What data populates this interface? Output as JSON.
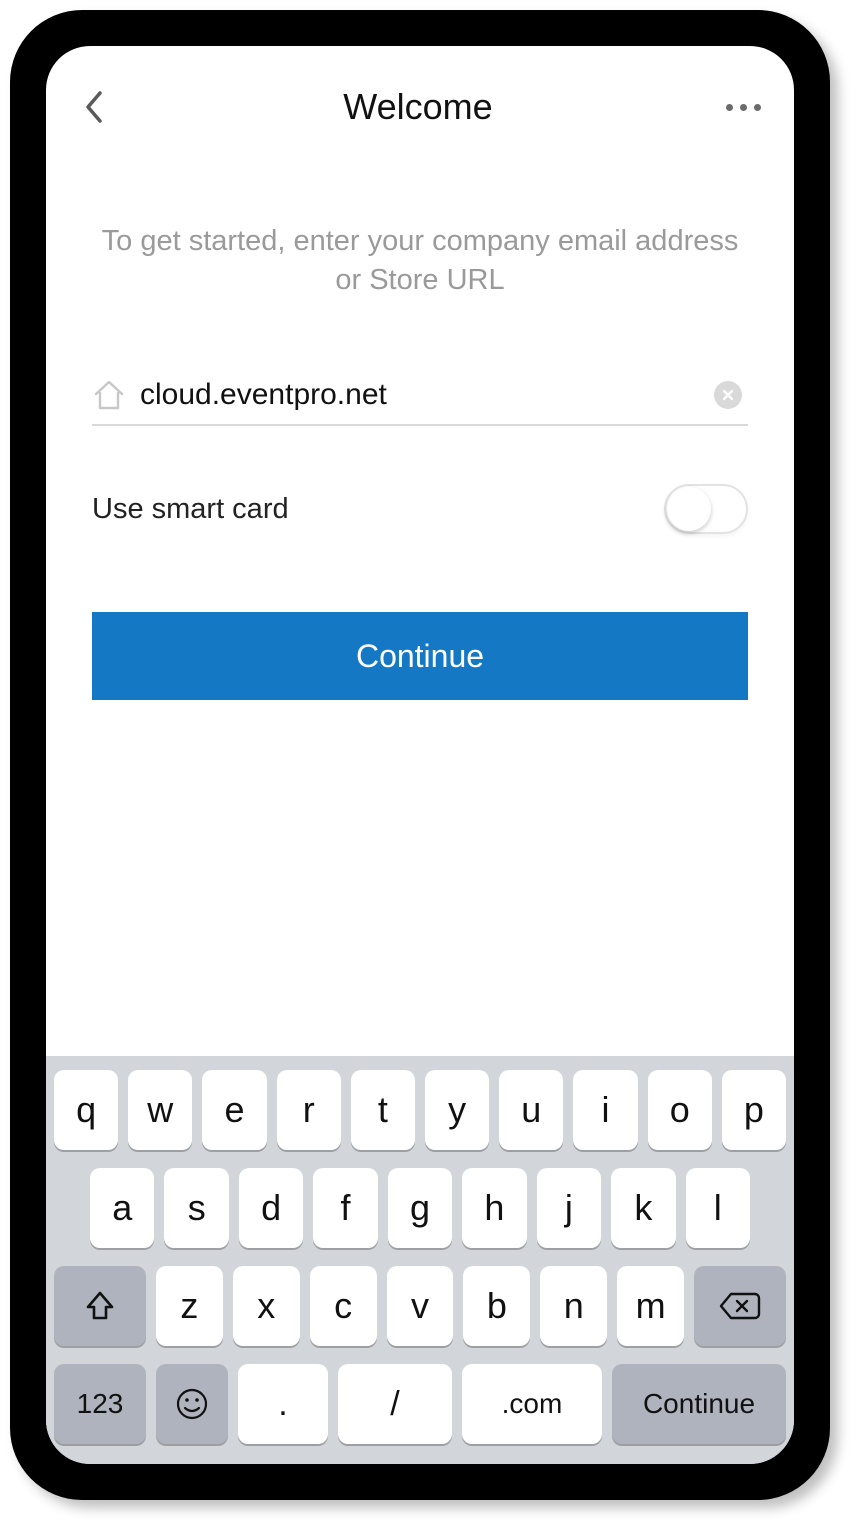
{
  "header": {
    "title": "Welcome"
  },
  "content": {
    "instruction": "To get started, enter your company email address or Store URL",
    "url_value": "cloud.eventpro.net",
    "smartcard_label": "Use smart card",
    "smartcard_on": false,
    "continue_label": "Continue"
  },
  "keyboard": {
    "row1": [
      "q",
      "w",
      "e",
      "r",
      "t",
      "y",
      "u",
      "i",
      "o",
      "p"
    ],
    "row2": [
      "a",
      "s",
      "d",
      "f",
      "g",
      "h",
      "j",
      "k",
      "l"
    ],
    "row3": [
      "z",
      "x",
      "c",
      "v",
      "b",
      "n",
      "m"
    ],
    "numeric_label": "123",
    "dot_label": ".",
    "slash_label": "/",
    "com_label": ".com",
    "continue_label": "Continue"
  },
  "icons": {
    "back": "chevron-left-icon",
    "more": "more-icon",
    "home": "home-icon",
    "clear": "clear-icon",
    "shift": "shift-icon",
    "backspace": "backspace-icon",
    "emoji": "emoji-icon"
  }
}
